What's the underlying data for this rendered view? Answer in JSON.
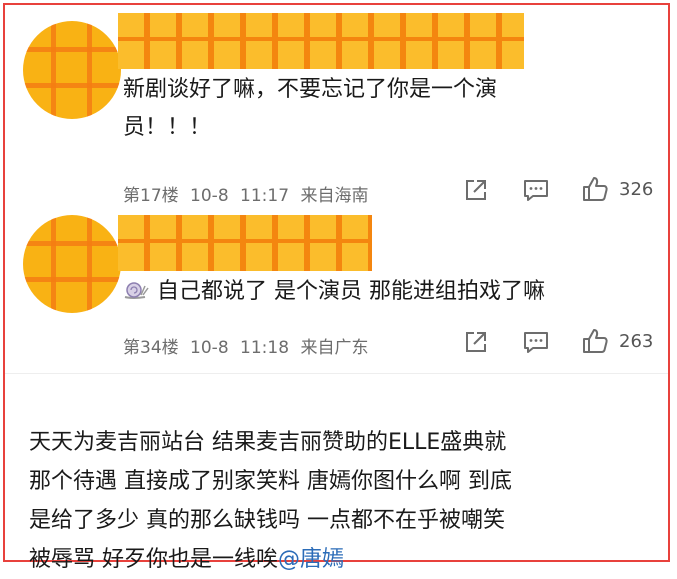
{
  "comments": [
    {
      "text_line1": "新剧谈好了嘛，不要忘记了你是一个演",
      "text_line2": "员！！！",
      "floor": "第17楼",
      "date": "10-8",
      "time": "11:17",
      "location": "来自海南",
      "likes": "326"
    },
    {
      "text": "自己都说了 是个演员 那能进组拍戏了嘛",
      "floor": "第34楼",
      "date": "10-8",
      "time": "11:18",
      "location": "来自广东",
      "likes": "263"
    }
  ],
  "post": {
    "line1": "天天为麦吉丽站台 结果麦吉丽赞助的ELLE盛典就",
    "line2": "那个待遇 直接成了别家笑料 唐嫣你图什么啊 到底",
    "line3": "是给了多少 真的那么缺钱吗 一点都不在乎被嘲笑",
    "line4_text": "被辱骂 好歹你也是一线唉",
    "mention": "@唐嫣"
  },
  "colors": {
    "frame_border": "#e8413c",
    "avatar_fill": "#f9b214",
    "censor_stripe": "#f4860f",
    "meta_text": "#6d6d6d",
    "mention": "#2b6cb8"
  },
  "icons": [
    "share-icon",
    "comment-icon",
    "like-icon",
    "snail-emoji-icon"
  ]
}
